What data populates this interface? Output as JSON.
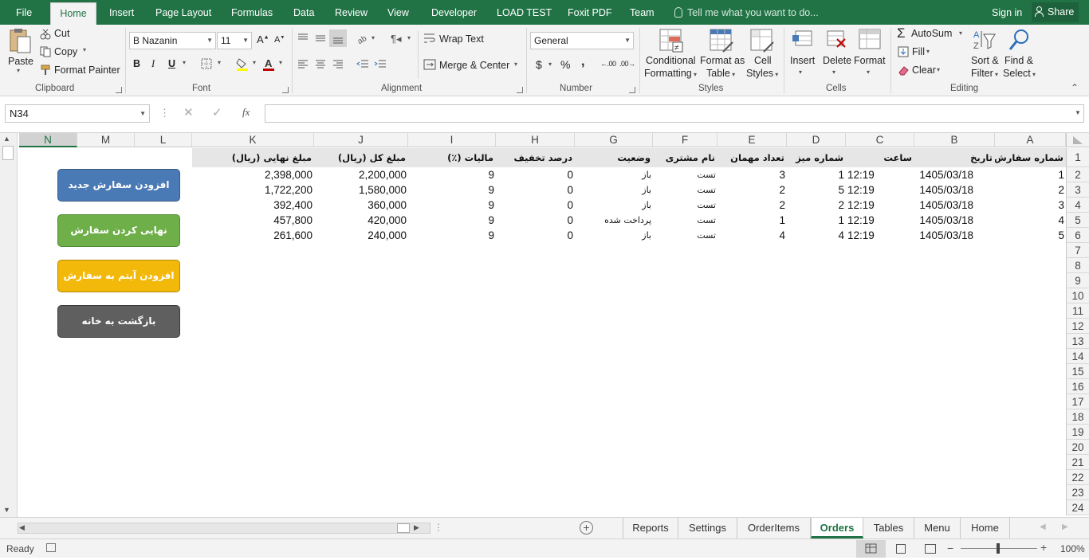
{
  "menu": {
    "tabs": [
      "File",
      "Home",
      "Insert",
      "Page Layout",
      "Formulas",
      "Data",
      "Review",
      "View",
      "Developer",
      "LOAD TEST",
      "Foxit PDF",
      "Team"
    ],
    "active_tab": "Home",
    "tell_me": "Tell me what you want to do...",
    "sign_in": "Sign in",
    "share": "Share"
  },
  "ribbon": {
    "clipboard": {
      "paste": "Paste",
      "cut": "Cut",
      "copy": "Copy",
      "format_painter": "Format Painter",
      "label": "Clipboard"
    },
    "font": {
      "name": "B Nazanin",
      "size": "11",
      "label": "Font",
      "bold": "B",
      "italic": "I",
      "underline": "U"
    },
    "alignment": {
      "wrap_text": "Wrap Text",
      "merge_center": "Merge & Center",
      "label": "Alignment"
    },
    "number": {
      "format": "General",
      "label": "Number",
      "currency": "$",
      "percent": "%",
      "comma": ","
    },
    "styles": {
      "conditional_1": "Conditional",
      "conditional_2": "Formatting",
      "format_as_1": "Format as",
      "format_as_2": "Table",
      "cell_1": "Cell",
      "cell_2": "Styles",
      "label": "Styles"
    },
    "cells": {
      "insert": "Insert",
      "delete": "Delete",
      "format": "Format",
      "label": "Cells"
    },
    "editing": {
      "autosum": "AutoSum",
      "fill": "Fill",
      "clear": "Clear",
      "sort_1": "Sort &",
      "sort_2": "Filter",
      "find_1": "Find &",
      "find_2": "Select",
      "label": "Editing"
    }
  },
  "formula_bar": {
    "name_box": "N34",
    "fx": "fx",
    "formula": ""
  },
  "grid": {
    "columns": [
      "N",
      "M",
      "L",
      "K",
      "J",
      "I",
      "H",
      "G",
      "F",
      "E",
      "D",
      "C",
      "B",
      "A"
    ],
    "selected_column": "N",
    "rows": [
      "1",
      "2",
      "3",
      "4",
      "5",
      "6",
      "7",
      "8",
      "9",
      "10",
      "11",
      "12",
      "13",
      "14",
      "15",
      "16",
      "17",
      "18",
      "19",
      "20",
      "21",
      "22",
      "23",
      "24"
    ],
    "headers": {
      "A": "شماره سفارش",
      "B": "تاریخ",
      "C": "ساعت",
      "D": "شماره میز",
      "E": "تعداد مهمان",
      "F": "نام مشتری",
      "G": "وضعیت",
      "H": "درصد تخفیف",
      "I": "مالیات (٪)",
      "J": "مبلغ کل (ریال)",
      "K": "مبلغ نهایی (ریال)"
    },
    "orders": [
      {
        "A": "1",
        "B": "1405/03/18",
        "C": "12:19",
        "D": "1",
        "E": "3",
        "F": "تست",
        "G": "باز",
        "H": "0",
        "I": "9",
        "J": "2,200,000",
        "K": "2,398,000"
      },
      {
        "A": "2",
        "B": "1405/03/18",
        "C": "12:19",
        "D": "5",
        "E": "2",
        "F": "تست",
        "G": "باز",
        "H": "0",
        "I": "9",
        "J": "1,580,000",
        "K": "1,722,200"
      },
      {
        "A": "3",
        "B": "1405/03/18",
        "C": "12:19",
        "D": "2",
        "E": "2",
        "F": "تست",
        "G": "باز",
        "H": "0",
        "I": "9",
        "J": "360,000",
        "K": "392,400"
      },
      {
        "A": "4",
        "B": "1405/03/18",
        "C": "12:19",
        "D": "1",
        "E": "1",
        "F": "تست",
        "G": "پرداخت شده",
        "H": "0",
        "I": "9",
        "J": "420,000",
        "K": "457,800"
      },
      {
        "A": "5",
        "B": "1405/03/18",
        "C": "12:19",
        "D": "4",
        "E": "4",
        "F": "تست",
        "G": "باز",
        "H": "0",
        "I": "9",
        "J": "240,000",
        "K": "261,600"
      }
    ],
    "buttons": [
      {
        "label": "افزودن سفارش جدید",
        "color": "#4a7ab5"
      },
      {
        "label": "نهایی کردن سفارش",
        "color": "#6faf4a"
      },
      {
        "label": "افزودن آیتم به سفارش",
        "color": "#f2b90a"
      },
      {
        "label": "بازگشت به خانه",
        "color": "#5f5f5f"
      }
    ]
  },
  "sheets": {
    "tabs": [
      "Reports",
      "Settings",
      "OrderItems",
      "Orders",
      "Tables",
      "Menu",
      "Home"
    ],
    "active": "Orders"
  },
  "status": {
    "ready": "Ready",
    "zoom": "100%"
  },
  "colors": {
    "accent": "#217346"
  }
}
